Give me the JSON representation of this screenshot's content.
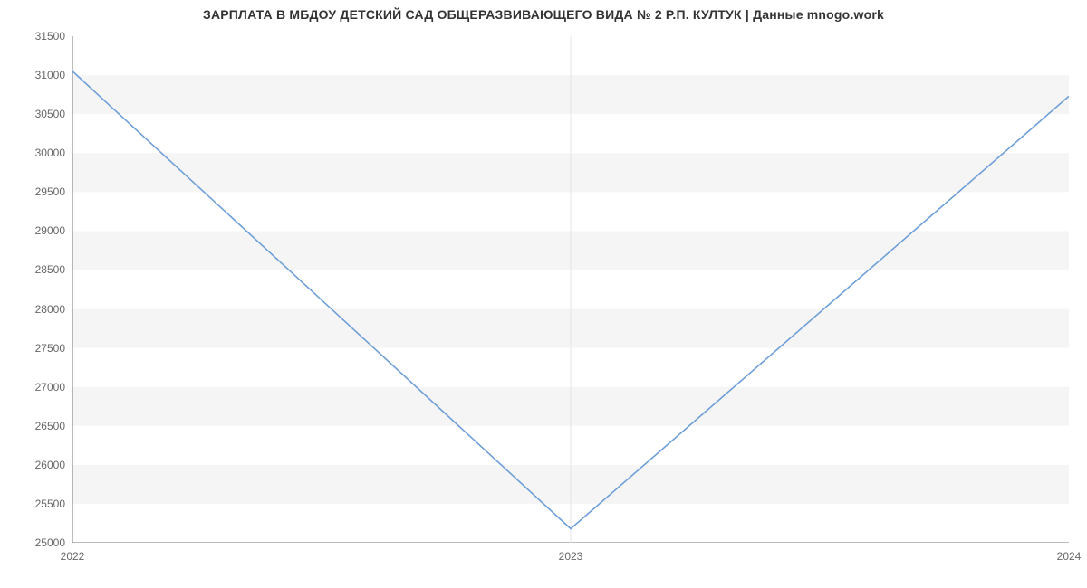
{
  "chart_data": {
    "type": "line",
    "title": "ЗАРПЛАТА В МБДОУ ДЕТСКИЙ САД ОБЩЕРАЗВИВАЮЩЕГО ВИДА № 2 Р.П. КУЛТУК | Данные mnogo.work",
    "xlabel": "",
    "ylabel": "",
    "x": [
      "2022",
      "2023",
      "2024"
    ],
    "values": [
      31050,
      25180,
      30730
    ],
    "ylim": [
      25000,
      31500
    ],
    "y_ticks": [
      25000,
      25500,
      26000,
      26500,
      27000,
      27500,
      28000,
      28500,
      29000,
      29500,
      30000,
      30500,
      31000,
      31500
    ],
    "line_color": "#6f9fd8",
    "band_color": "#f5f5f5"
  }
}
